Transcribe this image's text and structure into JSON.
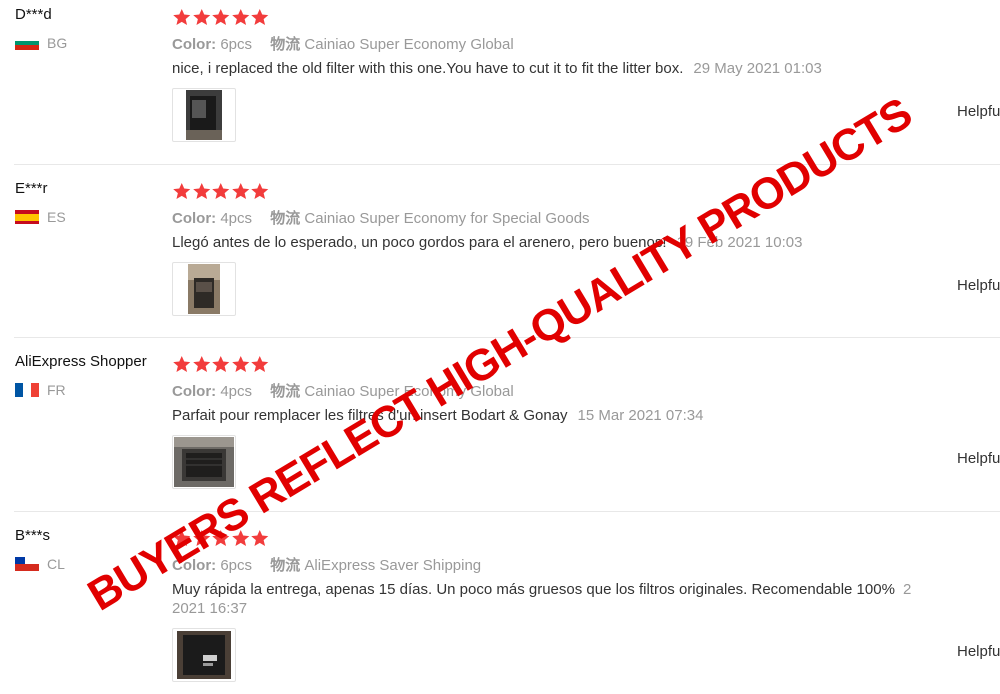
{
  "reviews": [
    {
      "user": "D***d",
      "country": "BG",
      "color_label": "Color:",
      "color_value": "6pcs",
      "shipping_label": "物流",
      "shipping_value": "Cainiao Super Economy Global",
      "text": "nice, i replaced the old filter with this one.You have to cut it to fit the litter box.",
      "date": "29 May 2021 01:03",
      "helpful": "Helpfu",
      "rating": 5
    },
    {
      "user": "E***r",
      "country": "ES",
      "color_label": "Color:",
      "color_value": "4pcs",
      "shipping_label": "物流",
      "shipping_value": "Cainiao Super Economy for Special Goods",
      "text": "Llegó antes de lo esperado, un poco gordos para el arenero, pero buenos!",
      "date": "19 Feb 2021 10:03",
      "helpful": "Helpfu",
      "rating": 5
    },
    {
      "user": "AliExpress Shopper",
      "country": "FR",
      "color_label": "Color:",
      "color_value": "4pcs",
      "shipping_label": "物流",
      "shipping_value": "Cainiao Super Economy Global",
      "text": "Parfait pour remplacer les filtres d'un insert Bodart & Gonay",
      "date": "15 Mar 2021 07:34",
      "helpful": "Helpfu",
      "rating": 5
    },
    {
      "user": "B***s",
      "country": "CL",
      "color_label": "Color:",
      "color_value": "6pcs",
      "shipping_label": "物流",
      "shipping_value": "AliExpress Saver Shipping",
      "text": "Muy rápida la entrega, apenas 15 días. Un poco más gruesos que los filtros originales. Recomendable 100%",
      "date_part1": "2",
      "date_part2": "2021 16:37",
      "helpful": "Helpfu",
      "rating": 5
    }
  ],
  "watermark": "BUYERS REFLECT HIGH-QUALITY PRODUCTS",
  "colors": {
    "star": "#f23c3c",
    "watermark": "#e10000",
    "muted": "#999999"
  }
}
